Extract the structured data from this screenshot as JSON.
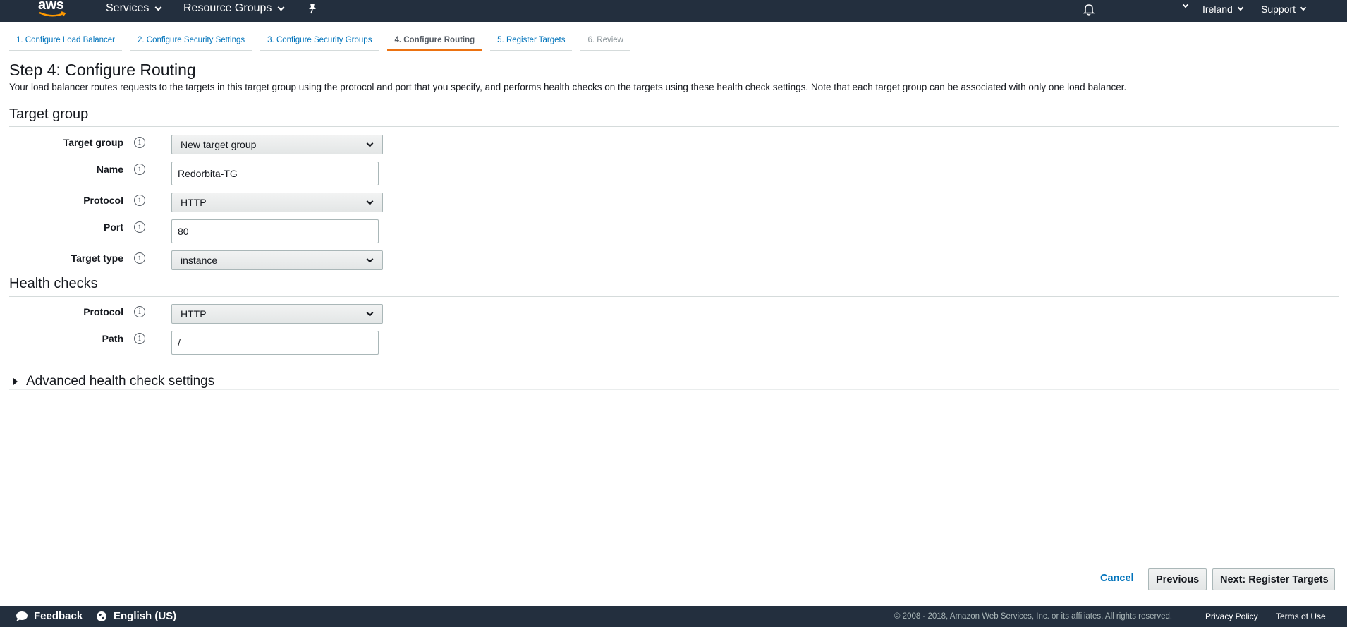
{
  "nav": {
    "logo": "aws",
    "services": "Services",
    "resource_groups": "Resource Groups",
    "region": "Ireland",
    "support": "Support"
  },
  "tabs": [
    {
      "label": "1. Configure Load Balancer"
    },
    {
      "label": "2. Configure Security Settings"
    },
    {
      "label": "3. Configure Security Groups"
    },
    {
      "label": "4. Configure Routing"
    },
    {
      "label": "5. Register Targets"
    },
    {
      "label": "6. Review"
    }
  ],
  "page": {
    "title": "Step 4: Configure Routing",
    "description": "Your load balancer routes requests to the targets in this target group using the protocol and port that you specify, and performs health checks on the targets using these health check settings. Note that each target group can be associated with only one load balancer."
  },
  "target_group": {
    "section_title": "Target group",
    "target_group_label": "Target group",
    "target_group_value": "New target group",
    "name_label": "Name",
    "name_value": "Redorbita-TG",
    "protocol_label": "Protocol",
    "protocol_value": "HTTP",
    "port_label": "Port",
    "port_value": "80",
    "target_type_label": "Target type",
    "target_type_value": "instance"
  },
  "health_checks": {
    "section_title": "Health checks",
    "protocol_label": "Protocol",
    "protocol_value": "HTTP",
    "path_label": "Path",
    "path_value": "/"
  },
  "advanced": {
    "label": "Advanced health check settings"
  },
  "actions": {
    "cancel": "Cancel",
    "previous": "Previous",
    "next": "Next: Register Targets"
  },
  "footer": {
    "feedback": "Feedback",
    "language": "English (US)",
    "copyright": "© 2008 - 2018, Amazon Web Services, Inc. or its affiliates. All rights reserved.",
    "privacy": "Privacy Policy",
    "terms": "Terms of Use"
  },
  "icons": {
    "info": "i"
  },
  "colors": {
    "nav_bg": "#232f3e",
    "link": "#0073bb",
    "active_tab": "#ec7211"
  }
}
